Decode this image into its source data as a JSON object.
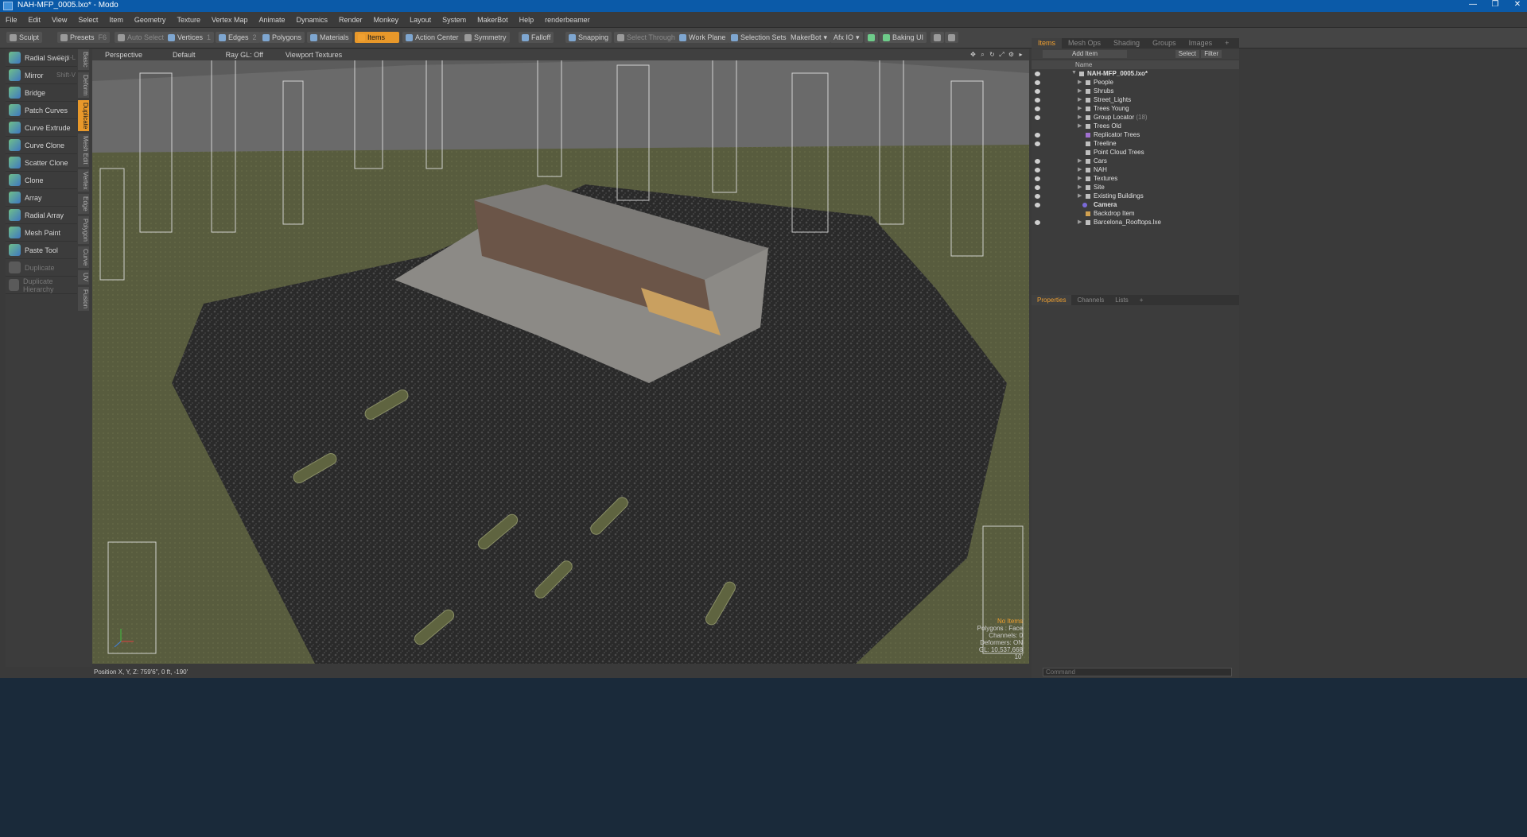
{
  "window": {
    "title": "NAH-MFP_0005.lxo* - Modo",
    "controls": [
      "—",
      "❐",
      "✕"
    ]
  },
  "menu": [
    "File",
    "Edit",
    "View",
    "Select",
    "Item",
    "Geometry",
    "Texture",
    "Vertex Map",
    "Animate",
    "Dynamics",
    "Render",
    "Monkey",
    "Layout",
    "System",
    "MakerBot",
    "Help",
    "renderbeamer"
  ],
  "toolbar": {
    "sculpt": "Sculpt",
    "presets": "Presets",
    "presets_key": "F6",
    "auto_select": "Auto Select",
    "vertices": "Vertices",
    "vertices_key": "1",
    "edges": "Edges",
    "edges_key": "2",
    "polygons": "Polygons",
    "materials": "Materials",
    "items": "Items",
    "action_center": "Action Center",
    "symmetry": "Symmetry",
    "falloff": "Falloff",
    "snapping": "Snapping",
    "select_through": "Select Through",
    "work_plane": "Work Plane",
    "selection_sets": "Selection Sets",
    "makerbot": "MakerBot",
    "afx_io": "Afx IO",
    "baking_ui": "Baking UI"
  },
  "tools": [
    {
      "label": "Radial Sweep",
      "shortcut": "Shift-L",
      "enabled": true
    },
    {
      "label": "Mirror",
      "shortcut": "Shift-V",
      "enabled": true
    },
    {
      "label": "Bridge",
      "shortcut": "",
      "enabled": true
    },
    {
      "label": "Patch Curves",
      "shortcut": "",
      "enabled": true
    },
    {
      "label": "Curve Extrude",
      "shortcut": "",
      "enabled": true
    },
    {
      "label": "Curve Clone",
      "shortcut": "",
      "enabled": true
    },
    {
      "label": "Scatter Clone",
      "shortcut": "",
      "enabled": true
    },
    {
      "label": "Clone",
      "shortcut": "",
      "enabled": true
    },
    {
      "label": "Array",
      "shortcut": "",
      "enabled": true
    },
    {
      "label": "Radial Array",
      "shortcut": "",
      "enabled": true
    },
    {
      "label": "Mesh Paint",
      "shortcut": "",
      "enabled": true
    },
    {
      "label": "Paste Tool",
      "shortcut": "",
      "enabled": true
    },
    {
      "label": "Duplicate",
      "shortcut": "",
      "enabled": false
    },
    {
      "label": "Duplicate Hierarchy",
      "shortcut": "",
      "enabled": false
    }
  ],
  "side_tabs": [
    "Basic",
    "Deform",
    "Duplicate",
    "Mesh Edit",
    "Vertex",
    "Edge",
    "Polygon",
    "Curve",
    "UV",
    "Fusion"
  ],
  "viewport": {
    "labels": [
      "Perspective",
      "Default",
      "Ray GL: Off",
      "Viewport Textures"
    ],
    "info": {
      "no_items": "No Items",
      "polygons": "Polygons : Face",
      "channels": "Channels: 0",
      "deformers": "Deformers: ON",
      "gl": "GL: 10,537,668",
      "scale": "10'"
    }
  },
  "status": "Position X, Y, Z:  759'6\", 0 ft, -190'",
  "items_panel": {
    "tabs": [
      "Items",
      "Mesh Ops",
      "Shading",
      "Groups",
      "Images",
      "+"
    ],
    "add_item": "Add Item",
    "select": "Select",
    "filter": "Filter",
    "name_col": "Name",
    "tree": [
      {
        "label": "NAH-MFP_0005.lxo*",
        "level": 0,
        "suffix": ""
      },
      {
        "label": "People",
        "level": 1,
        "suffix": ""
      },
      {
        "label": "Shrubs",
        "level": 1,
        "suffix": ""
      },
      {
        "label": "Street_Lights",
        "level": 1,
        "suffix": ""
      },
      {
        "label": "Trees Young",
        "level": 1,
        "suffix": ""
      },
      {
        "label": "Group Locator",
        "level": 1,
        "suffix": " (18)"
      },
      {
        "label": "Trees Old",
        "level": 1,
        "suffix": ""
      },
      {
        "label": "Replicator Trees",
        "level": 1,
        "suffix": ""
      },
      {
        "label": "Treeline",
        "level": 1,
        "suffix": ""
      },
      {
        "label": "Point Cloud Trees",
        "level": 1,
        "suffix": ""
      },
      {
        "label": "Cars",
        "level": 1,
        "suffix": ""
      },
      {
        "label": "NAH",
        "level": 1,
        "suffix": ""
      },
      {
        "label": "Textures",
        "level": 1,
        "suffix": ""
      },
      {
        "label": "Site",
        "level": 1,
        "suffix": ""
      },
      {
        "label": "Existing Buildings",
        "level": 1,
        "suffix": ""
      },
      {
        "label": "Camera",
        "level": 1,
        "suffix": ""
      },
      {
        "label": "Backdrop Item",
        "level": 1,
        "suffix": ""
      },
      {
        "label": "Barcelona_Rooftops.lxe",
        "level": 1,
        "suffix": ""
      }
    ]
  },
  "props_panel": {
    "tabs": [
      "Properties",
      "Channels",
      "Lists",
      "+"
    ]
  },
  "command": {
    "placeholder": "Command"
  }
}
